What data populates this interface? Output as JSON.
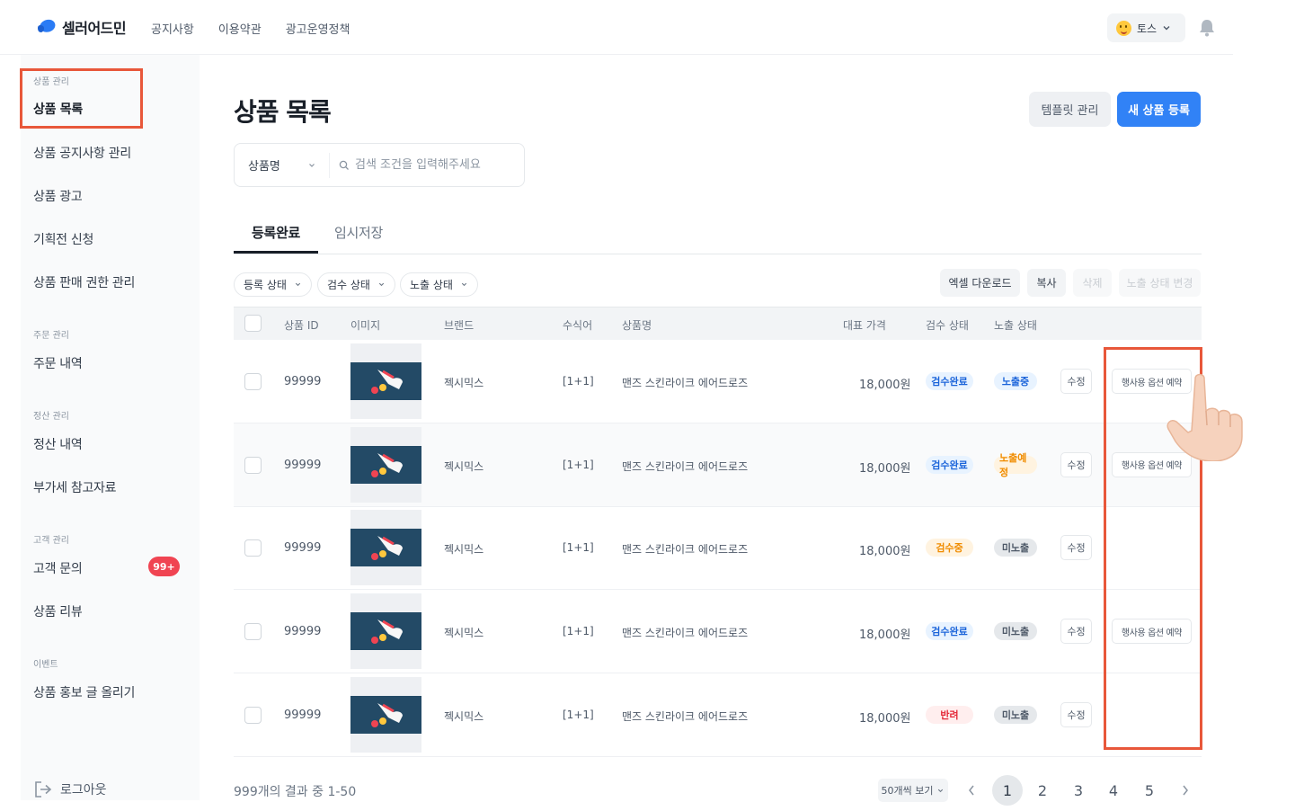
{
  "app": {
    "logo_text": "셀러어드민",
    "topnav": [
      "공지사항",
      "이용약관",
      "광고운영정책"
    ],
    "user_name": "토스"
  },
  "sidebar": {
    "groups": {
      "product": "상품 관리",
      "order": "주문 관리",
      "settlement": "정산 관리",
      "customer": "고객 관리",
      "event": "이벤트"
    },
    "items": {
      "product_list": "상품 목록",
      "product_notice": "상품 공지사항 관리",
      "product_ad": "상품 광고",
      "exhibition": "기획전 신청",
      "sales_permission": "상품 판매 권한 관리",
      "order_history": "주문 내역",
      "settlement_history": "정산 내역",
      "vat_reference": "부가세 참고자료",
      "customer_inquiry": "고객 문의",
      "product_review": "상품 리뷰",
      "promo_post": "상품 홍보 글 올리기"
    },
    "inquiry_badge": "99+",
    "logout": "로그아웃"
  },
  "main": {
    "title": "상품 목록",
    "template_button": "템플릿 관리",
    "new_product_button": "새 상품 등록",
    "search": {
      "field": "상품명",
      "placeholder": "검색 조건을 입력해주세요"
    },
    "tabs": [
      "등록완료",
      "임시저장"
    ],
    "filters": [
      "등록 상태",
      "검수 상태",
      "노출 상태"
    ],
    "actions": {
      "excel": "엑셀 다운로드",
      "copy": "복사",
      "delete": "삭제",
      "change_exposure": "노출 상태 변경"
    },
    "columns": {
      "id": "상품 ID",
      "image": "이미지",
      "brand": "브랜드",
      "modifier": "수식어",
      "name": "상품명",
      "price": "대표 가격",
      "review": "검수 상태",
      "exposure": "노출 상태"
    },
    "rows": [
      {
        "id": "99999",
        "brand": "젝시믹스",
        "modifier": "[1+1]",
        "name": "맨즈 스킨라이크 에어드로즈",
        "price": "18,000원",
        "review": "검수완료",
        "exposure": "노출중",
        "edit": "수정",
        "event": "행사용 옵션 예약"
      },
      {
        "id": "99999",
        "brand": "젝시믹스",
        "modifier": "[1+1]",
        "name": "맨즈 스킨라이크 에어드로즈",
        "price": "18,000원",
        "review": "검수완료",
        "exposure": "노출예정",
        "edit": "수정",
        "event": "행사용 옵션 예약"
      },
      {
        "id": "99999",
        "brand": "젝시믹스",
        "modifier": "[1+1]",
        "name": "맨즈 스킨라이크 에어드로즈",
        "price": "18,000원",
        "review": "검수중",
        "exposure": "미노출",
        "edit": "수정",
        "event": ""
      },
      {
        "id": "99999",
        "brand": "젝시믹스",
        "modifier": "[1+1]",
        "name": "맨즈 스킨라이크 에어드로즈",
        "price": "18,000원",
        "review": "검수완료",
        "exposure": "미노출",
        "edit": "수정",
        "event": "행사용 옵션 예약"
      },
      {
        "id": "99999",
        "brand": "젝시믹스",
        "modifier": "[1+1]",
        "name": "맨즈 스킨라이크 에어드로즈",
        "price": "18,000원",
        "review": "반려",
        "exposure": "미노출",
        "edit": "수정",
        "event": ""
      }
    ],
    "result_count": "999개의 결과 중 1-50",
    "per_page": "50개씩 보기",
    "pages": [
      "1",
      "2",
      "3",
      "4",
      "5"
    ],
    "current_page": "1"
  },
  "colors": {
    "primary": "#3182f6",
    "highlight": "#e8573a",
    "badge": "#f04452",
    "status_done": "#3182f6",
    "status_pending": "#fe9800",
    "status_rejected": "#f04452",
    "status_hidden": "#4e5968"
  }
}
